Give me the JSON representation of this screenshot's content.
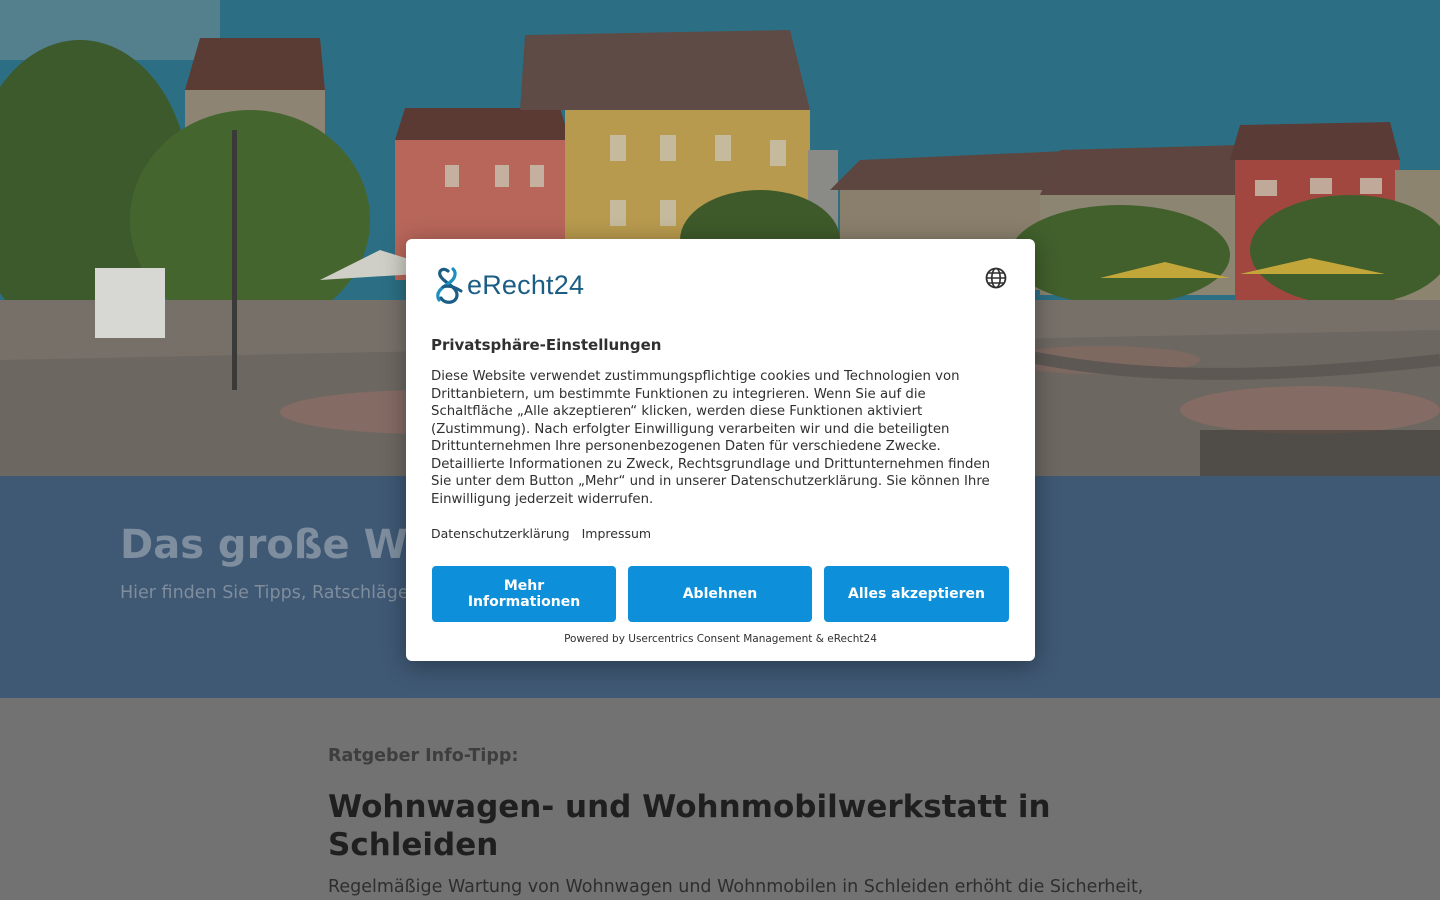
{
  "hero": {
    "image": "town-square-photo"
  },
  "intro": {
    "title": "Das große Wis",
    "description": "Hier finden Sie Tipps, Ratschläge u                                                                                                                   uten aus Euskirchen und der Region."
  },
  "article": {
    "tip_label": "Ratgeber Info-Tipp:",
    "title": "Wohnwagen- und Wohnmobilwerkstatt in Schleiden",
    "intro": "Regelmäßige Wartung von Wohnwagen und Wohnmobilen in Schleiden erhöht die Sicherheit,"
  },
  "consent": {
    "logo_text": "eRecht24",
    "language_icon": "globe-icon",
    "title": "Privatsphäre-Einstellungen",
    "body": "Diese Website verwendet zustimmungspflichtige cookies und Technologien von Drittanbietern, um bestimmte Funktionen zu integrieren. Wenn Sie auf die Schaltfläche „Alle akzeptieren“ klicken, werden diese Funktionen aktiviert (Zustimmung). Nach erfolgter Einwilligung verarbeiten wir und die beteiligten Drittunternehmen Ihre personenbezogenen Daten für verschiedene Zwecke. Detaillierte Informationen zu Zweck, Rechtsgrundlage und Drittunternehmen finden Sie unter dem Button „Mehr“ und in unserer Datenschutzerklärung. Sie können Ihre Einwilligung jederzeit widerrufen.",
    "links": {
      "privacy": "Datenschutzerklärung",
      "imprint": "Impressum"
    },
    "buttons": {
      "more": "Mehr Informationen",
      "deny": "Ablehnen",
      "accept": "Alles akzeptieren"
    },
    "powered_by": "Powered by Usercentrics Consent Management & eRecht24"
  },
  "colors": {
    "button_blue": "#0e8fd9",
    "intro_band": "#3f5874",
    "logo_blue": "#1b5d84"
  }
}
